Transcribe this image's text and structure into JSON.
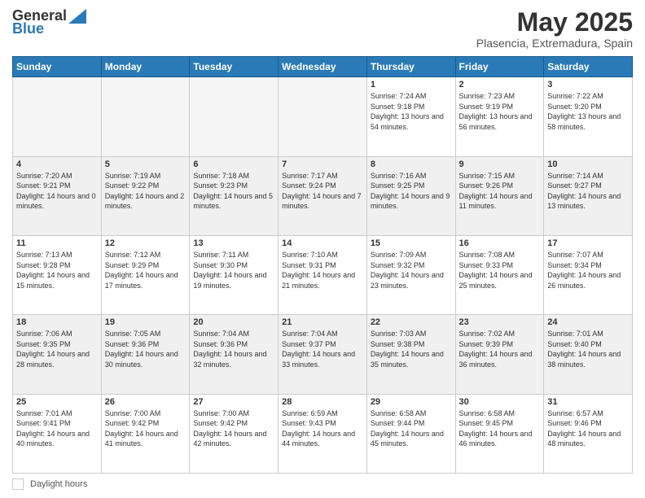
{
  "header": {
    "logo_general": "General",
    "logo_blue": "Blue",
    "title": "May 2025",
    "subtitle": "Plasencia, Extremadura, Spain"
  },
  "days_of_week": [
    "Sunday",
    "Monday",
    "Tuesday",
    "Wednesday",
    "Thursday",
    "Friday",
    "Saturday"
  ],
  "footer": {
    "label": "Daylight hours"
  },
  "weeks": [
    [
      {
        "day": "",
        "sunrise": "",
        "sunset": "",
        "daylight": "",
        "empty": true
      },
      {
        "day": "",
        "sunrise": "",
        "sunset": "",
        "daylight": "",
        "empty": true
      },
      {
        "day": "",
        "sunrise": "",
        "sunset": "",
        "daylight": "",
        "empty": true
      },
      {
        "day": "",
        "sunrise": "",
        "sunset": "",
        "daylight": "",
        "empty": true
      },
      {
        "day": "1",
        "sunrise": "Sunrise: 7:24 AM",
        "sunset": "Sunset: 9:18 PM",
        "daylight": "Daylight: 13 hours and 54 minutes."
      },
      {
        "day": "2",
        "sunrise": "Sunrise: 7:23 AM",
        "sunset": "Sunset: 9:19 PM",
        "daylight": "Daylight: 13 hours and 56 minutes."
      },
      {
        "day": "3",
        "sunrise": "Sunrise: 7:22 AM",
        "sunset": "Sunset: 9:20 PM",
        "daylight": "Daylight: 13 hours and 58 minutes."
      }
    ],
    [
      {
        "day": "4",
        "sunrise": "Sunrise: 7:20 AM",
        "sunset": "Sunset: 9:21 PM",
        "daylight": "Daylight: 14 hours and 0 minutes."
      },
      {
        "day": "5",
        "sunrise": "Sunrise: 7:19 AM",
        "sunset": "Sunset: 9:22 PM",
        "daylight": "Daylight: 14 hours and 2 minutes."
      },
      {
        "day": "6",
        "sunrise": "Sunrise: 7:18 AM",
        "sunset": "Sunset: 9:23 PM",
        "daylight": "Daylight: 14 hours and 5 minutes."
      },
      {
        "day": "7",
        "sunrise": "Sunrise: 7:17 AM",
        "sunset": "Sunset: 9:24 PM",
        "daylight": "Daylight: 14 hours and 7 minutes."
      },
      {
        "day": "8",
        "sunrise": "Sunrise: 7:16 AM",
        "sunset": "Sunset: 9:25 PM",
        "daylight": "Daylight: 14 hours and 9 minutes."
      },
      {
        "day": "9",
        "sunrise": "Sunrise: 7:15 AM",
        "sunset": "Sunset: 9:26 PM",
        "daylight": "Daylight: 14 hours and 11 minutes."
      },
      {
        "day": "10",
        "sunrise": "Sunrise: 7:14 AM",
        "sunset": "Sunset: 9:27 PM",
        "daylight": "Daylight: 14 hours and 13 minutes."
      }
    ],
    [
      {
        "day": "11",
        "sunrise": "Sunrise: 7:13 AM",
        "sunset": "Sunset: 9:28 PM",
        "daylight": "Daylight: 14 hours and 15 minutes."
      },
      {
        "day": "12",
        "sunrise": "Sunrise: 7:12 AM",
        "sunset": "Sunset: 9:29 PM",
        "daylight": "Daylight: 14 hours and 17 minutes."
      },
      {
        "day": "13",
        "sunrise": "Sunrise: 7:11 AM",
        "sunset": "Sunset: 9:30 PM",
        "daylight": "Daylight: 14 hours and 19 minutes."
      },
      {
        "day": "14",
        "sunrise": "Sunrise: 7:10 AM",
        "sunset": "Sunset: 9:31 PM",
        "daylight": "Daylight: 14 hours and 21 minutes."
      },
      {
        "day": "15",
        "sunrise": "Sunrise: 7:09 AM",
        "sunset": "Sunset: 9:32 PM",
        "daylight": "Daylight: 14 hours and 23 minutes."
      },
      {
        "day": "16",
        "sunrise": "Sunrise: 7:08 AM",
        "sunset": "Sunset: 9:33 PM",
        "daylight": "Daylight: 14 hours and 25 minutes."
      },
      {
        "day": "17",
        "sunrise": "Sunrise: 7:07 AM",
        "sunset": "Sunset: 9:34 PM",
        "daylight": "Daylight: 14 hours and 26 minutes."
      }
    ],
    [
      {
        "day": "18",
        "sunrise": "Sunrise: 7:06 AM",
        "sunset": "Sunset: 9:35 PM",
        "daylight": "Daylight: 14 hours and 28 minutes."
      },
      {
        "day": "19",
        "sunrise": "Sunrise: 7:05 AM",
        "sunset": "Sunset: 9:36 PM",
        "daylight": "Daylight: 14 hours and 30 minutes."
      },
      {
        "day": "20",
        "sunrise": "Sunrise: 7:04 AM",
        "sunset": "Sunset: 9:36 PM",
        "daylight": "Daylight: 14 hours and 32 minutes."
      },
      {
        "day": "21",
        "sunrise": "Sunrise: 7:04 AM",
        "sunset": "Sunset: 9:37 PM",
        "daylight": "Daylight: 14 hours and 33 minutes."
      },
      {
        "day": "22",
        "sunrise": "Sunrise: 7:03 AM",
        "sunset": "Sunset: 9:38 PM",
        "daylight": "Daylight: 14 hours and 35 minutes."
      },
      {
        "day": "23",
        "sunrise": "Sunrise: 7:02 AM",
        "sunset": "Sunset: 9:39 PM",
        "daylight": "Daylight: 14 hours and 36 minutes."
      },
      {
        "day": "24",
        "sunrise": "Sunrise: 7:01 AM",
        "sunset": "Sunset: 9:40 PM",
        "daylight": "Daylight: 14 hours and 38 minutes."
      }
    ],
    [
      {
        "day": "25",
        "sunrise": "Sunrise: 7:01 AM",
        "sunset": "Sunset: 9:41 PM",
        "daylight": "Daylight: 14 hours and 40 minutes."
      },
      {
        "day": "26",
        "sunrise": "Sunrise: 7:00 AM",
        "sunset": "Sunset: 9:42 PM",
        "daylight": "Daylight: 14 hours and 41 minutes."
      },
      {
        "day": "27",
        "sunrise": "Sunrise: 7:00 AM",
        "sunset": "Sunset: 9:42 PM",
        "daylight": "Daylight: 14 hours and 42 minutes."
      },
      {
        "day": "28",
        "sunrise": "Sunrise: 6:59 AM",
        "sunset": "Sunset: 9:43 PM",
        "daylight": "Daylight: 14 hours and 44 minutes."
      },
      {
        "day": "29",
        "sunrise": "Sunrise: 6:58 AM",
        "sunset": "Sunset: 9:44 PM",
        "daylight": "Daylight: 14 hours and 45 minutes."
      },
      {
        "day": "30",
        "sunrise": "Sunrise: 6:58 AM",
        "sunset": "Sunset: 9:45 PM",
        "daylight": "Daylight: 14 hours and 46 minutes."
      },
      {
        "day": "31",
        "sunrise": "Sunrise: 6:57 AM",
        "sunset": "Sunset: 9:46 PM",
        "daylight": "Daylight: 14 hours and 48 minutes."
      }
    ]
  ]
}
